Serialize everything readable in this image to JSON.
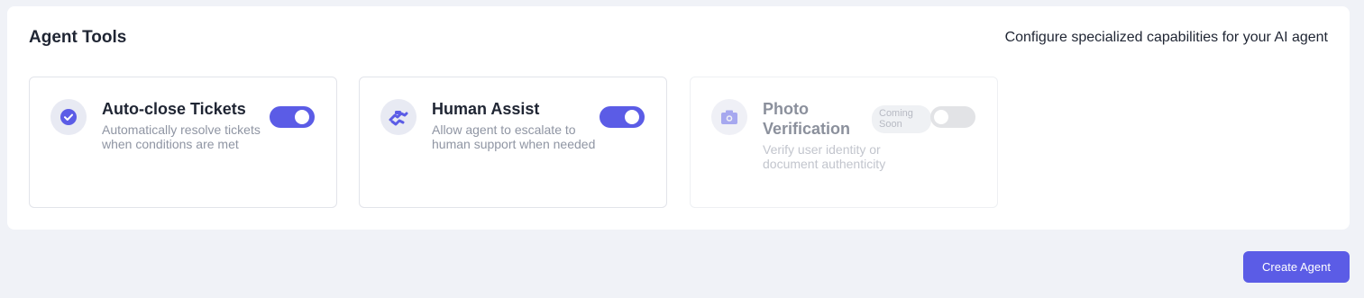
{
  "section": {
    "title": "Agent Tools",
    "subtitle": "Configure specialized capabilities for your AI agent"
  },
  "tools": [
    {
      "title": "Auto-close Tickets",
      "description": "Automatically resolve tickets when conditions are met",
      "icon": "check-circle-icon",
      "enabled": true
    },
    {
      "title": "Human Assist",
      "description": "Allow agent to escalate to human support when needed",
      "icon": "handshake-icon",
      "enabled": true
    },
    {
      "title": "Photo Verification",
      "description": "Verify user identity or document authenticity",
      "icon": "camera-icon",
      "enabled": false,
      "badge": "Coming Soon"
    }
  ],
  "colors": {
    "accent": "#5b5ce6",
    "page_background": "#f0f2f7"
  },
  "footer": {
    "create_label": "Create Agent"
  }
}
